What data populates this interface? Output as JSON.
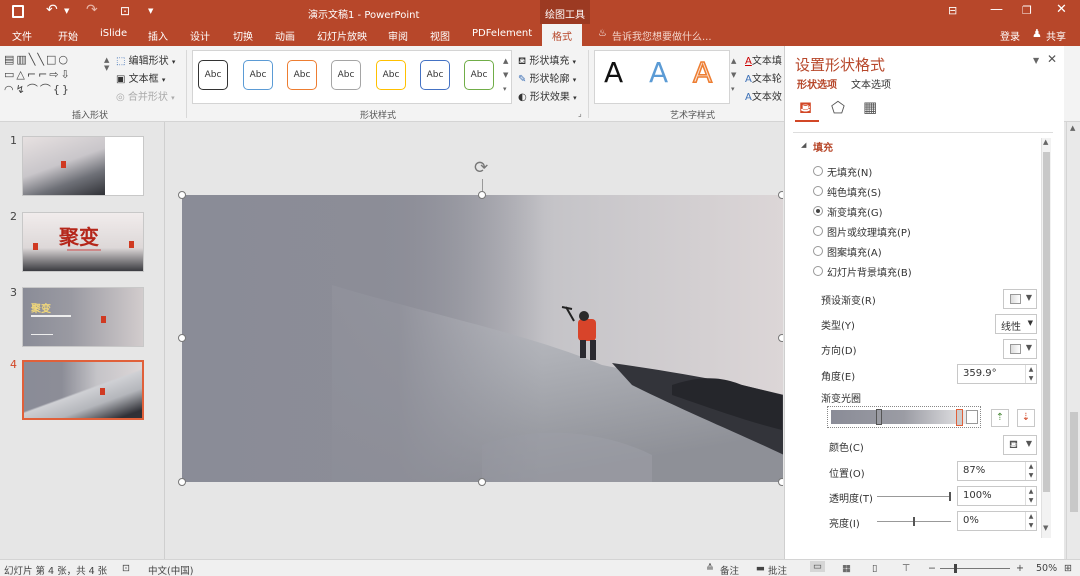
{
  "title_bar": {
    "doc_title": "演示文稿1 - PowerPoint",
    "context_tab": "绘图工具",
    "window_buttons": [
      "restore-ribbon-icon",
      "minimize-icon",
      "maximize-icon",
      "close-icon"
    ]
  },
  "tabs": [
    {
      "label": "文件"
    },
    {
      "label": "开始"
    },
    {
      "label": "iSlide"
    },
    {
      "label": "插入"
    },
    {
      "label": "设计"
    },
    {
      "label": "切换"
    },
    {
      "label": "动画"
    },
    {
      "label": "幻灯片放映"
    },
    {
      "label": "审阅"
    },
    {
      "label": "视图"
    },
    {
      "label": "PDFelement"
    },
    {
      "label": "格式"
    }
  ],
  "tell_me": "告诉我您想要做什么...",
  "login": "登录",
  "share": "共享",
  "ribbon": {
    "insert_shapes": {
      "label": "插入形状",
      "edit_shape": "编辑形状",
      "text_box": "文本框",
      "merge_shapes": "合并形状"
    },
    "shape_styles": {
      "label": "形状样式",
      "presets": [
        "Abc",
        "Abc",
        "Abc",
        "Abc",
        "Abc",
        "Abc",
        "Abc"
      ],
      "fill": "形状填充",
      "outline": "形状轮廓",
      "effects": "形状效果"
    },
    "wordart": {
      "label": "艺术字样式",
      "samples": [
        "A",
        "A",
        "A"
      ],
      "text_fill": "文本填",
      "text_outline": "文本轮",
      "text_effects": "文本效"
    }
  },
  "thumbnails": [
    {
      "number": "1"
    },
    {
      "number": "2",
      "title": "聚变"
    },
    {
      "number": "3",
      "title": "聚变"
    },
    {
      "number": "4"
    }
  ],
  "format_pane": {
    "title": "设置形状格式",
    "tab_shape": "形状选项",
    "tab_text": "文本选项",
    "section": "填充",
    "fill_options": [
      {
        "label": "无填充(N)",
        "selected": false
      },
      {
        "label": "纯色填充(S)",
        "selected": false
      },
      {
        "label": "渐变填充(G)",
        "selected": true
      },
      {
        "label": "图片或纹理填充(P)",
        "selected": false
      },
      {
        "label": "图案填充(A)",
        "selected": false
      },
      {
        "label": "幻灯片背景填充(B)",
        "selected": false
      }
    ],
    "preset_gradient_label": "预设渐变(R)",
    "type_label": "类型(Y)",
    "type_value": "线性",
    "direction_label": "方向(D)",
    "angle_label": "角度(E)",
    "angle_value": "359.9°",
    "gradient_stops_label": "渐变光圈",
    "color_label": "颜色(C)",
    "position_label": "位置(O)",
    "position_value": "87%",
    "transparency_label": "透明度(T)",
    "transparency_value": "100%",
    "transparency_level": 1.0,
    "brightness_label": "亮度(I)",
    "brightness_value": "0%",
    "brightness_level": 0.5
  },
  "status": {
    "slide_info": "幻灯片 第 4 张，共 4 张",
    "language": "中文(中国)",
    "notes": "备注",
    "comments": "批注",
    "zoom": "50%",
    "zoom_minus": "−",
    "zoom_plus": "+"
  },
  "colors": {
    "accent": "#b7472a",
    "selected_thumb": "#e0603a"
  }
}
